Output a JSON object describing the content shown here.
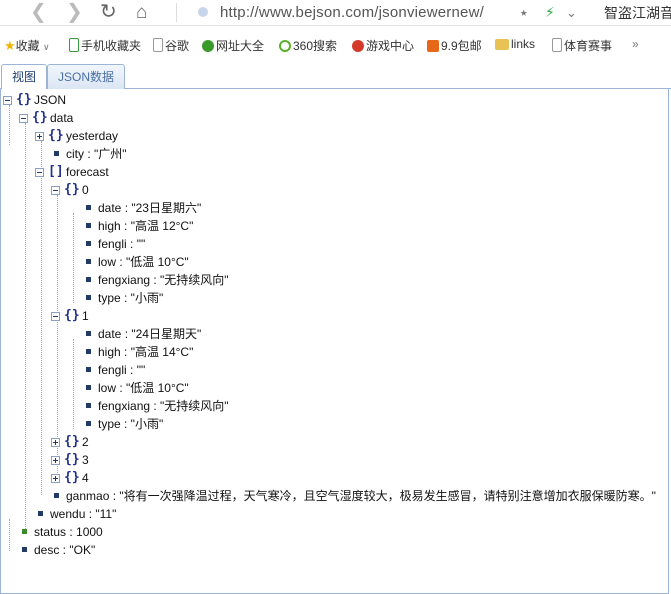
{
  "browser": {
    "url": "http://www.bejson.com/jsonviewernew/",
    "right_text": "智盗江湖音"
  },
  "bookmarks": [
    {
      "label": "收藏",
      "icon": "star-icon",
      "color": "#f0b400"
    },
    {
      "label": "手机收藏夹",
      "icon": "phone-icon",
      "color": "#3a9a3a"
    },
    {
      "label": "谷歌",
      "icon": "page-icon",
      "color": "#999999"
    },
    {
      "label": "网址大全",
      "icon": "compass-icon",
      "color": "#3a9a2a"
    },
    {
      "label": "360搜索",
      "icon": "ring-icon",
      "color": "#5bb12a"
    },
    {
      "label": "游戏中心",
      "icon": "game-icon",
      "color": "#d33a2a"
    },
    {
      "label": "9.9包邮",
      "icon": "tag-icon",
      "color": "#e8681a"
    },
    {
      "label": "links",
      "icon": "folder-icon",
      "color": "#e8c255"
    },
    {
      "label": "体育赛事",
      "icon": "page-icon",
      "color": "#999999"
    }
  ],
  "tabs": {
    "view": "视图",
    "json": "JSON数据"
  },
  "tree": [
    {
      "text": "JSON"
    },
    {
      "text": "data"
    },
    {
      "text": "yesterday"
    },
    {
      "text": "city : \"广州\""
    },
    {
      "text": "forecast"
    },
    {
      "text": "0"
    },
    {
      "text": "date : \"23日星期六\""
    },
    {
      "text": "high : \"高温 12°C\""
    },
    {
      "text": "fengli : \"\""
    },
    {
      "text": "low : \"低温 10°C\""
    },
    {
      "text": "fengxiang : \"无持续风向\""
    },
    {
      "text": "type : \"小雨\""
    },
    {
      "text": "1"
    },
    {
      "text": "date : \"24日星期天\""
    },
    {
      "text": "high : \"高温 14°C\""
    },
    {
      "text": "fengli : \"\""
    },
    {
      "text": "low : \"低温 10°C\""
    },
    {
      "text": "fengxiang : \"无持续风向\""
    },
    {
      "text": "type : \"小雨\""
    },
    {
      "text": "2"
    },
    {
      "text": "3"
    },
    {
      "text": "4"
    },
    {
      "text": "ganmao : \"将有一次强降温过程，天气寒冷，且空气湿度较大，极易发生感冒，请特别注意增加衣服保暖防寒。\""
    },
    {
      "text": "wendu : \"11\""
    },
    {
      "text": "status : 1000"
    },
    {
      "text": "desc : \"OK\""
    }
  ]
}
